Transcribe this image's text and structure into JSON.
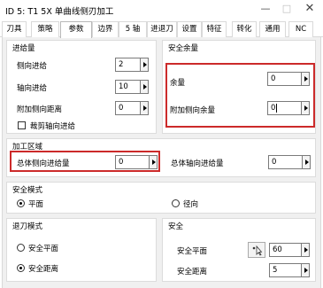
{
  "window": {
    "title": "ID 5: T1 5X 单曲线侧刃加工",
    "minimize": "—",
    "maximize": "□",
    "close": "✕"
  },
  "tabs": [
    {
      "label": "刀具"
    },
    {
      "label": "策略"
    },
    {
      "label": "参数"
    },
    {
      "label": "边界"
    },
    {
      "label": "5 轴"
    },
    {
      "label": "进退刀"
    },
    {
      "label": "设置"
    },
    {
      "label": "特征"
    },
    {
      "label": "转化"
    },
    {
      "label": "通用"
    },
    {
      "label": "NC"
    }
  ],
  "active_tab": "参数",
  "feed_group": {
    "title": "进给量",
    "side_feed": {
      "label": "侧向进给",
      "value": "2"
    },
    "axial_feed": {
      "label": "轴向进给",
      "value": "10"
    },
    "extra_side_distance": {
      "label": "附加侧向距离",
      "value": "0"
    },
    "trim_axial_feed": {
      "label": "裁剪轴向进给",
      "checked": false
    }
  },
  "safety_margin_group": {
    "title": "安全余量",
    "margin": {
      "label": "余量",
      "value": "0"
    },
    "extra_side_margin": {
      "label": "附加侧向余量",
      "value": "0"
    }
  },
  "machining_area_group": {
    "title": "加工区域",
    "total_side_feed": {
      "label": "总体侧向进给量",
      "value": "0"
    },
    "total_axial_feed": {
      "label": "总体轴向进给量",
      "value": "0"
    }
  },
  "safety_mode_group": {
    "title": "安全模式",
    "plane": {
      "label": "平面",
      "selected": true
    },
    "radial": {
      "label": "径向",
      "selected": false
    }
  },
  "retract_mode_group": {
    "title": "退刀模式",
    "safe_plane": {
      "label": "安全平面",
      "selected": false
    },
    "safe_distance": {
      "label": "安全距离",
      "selected": true
    }
  },
  "safety_group": {
    "title": "安全",
    "safe_plane": {
      "label": "安全平面",
      "value": "60"
    },
    "safe_distance": {
      "label": "安全距离",
      "value": "5"
    }
  }
}
